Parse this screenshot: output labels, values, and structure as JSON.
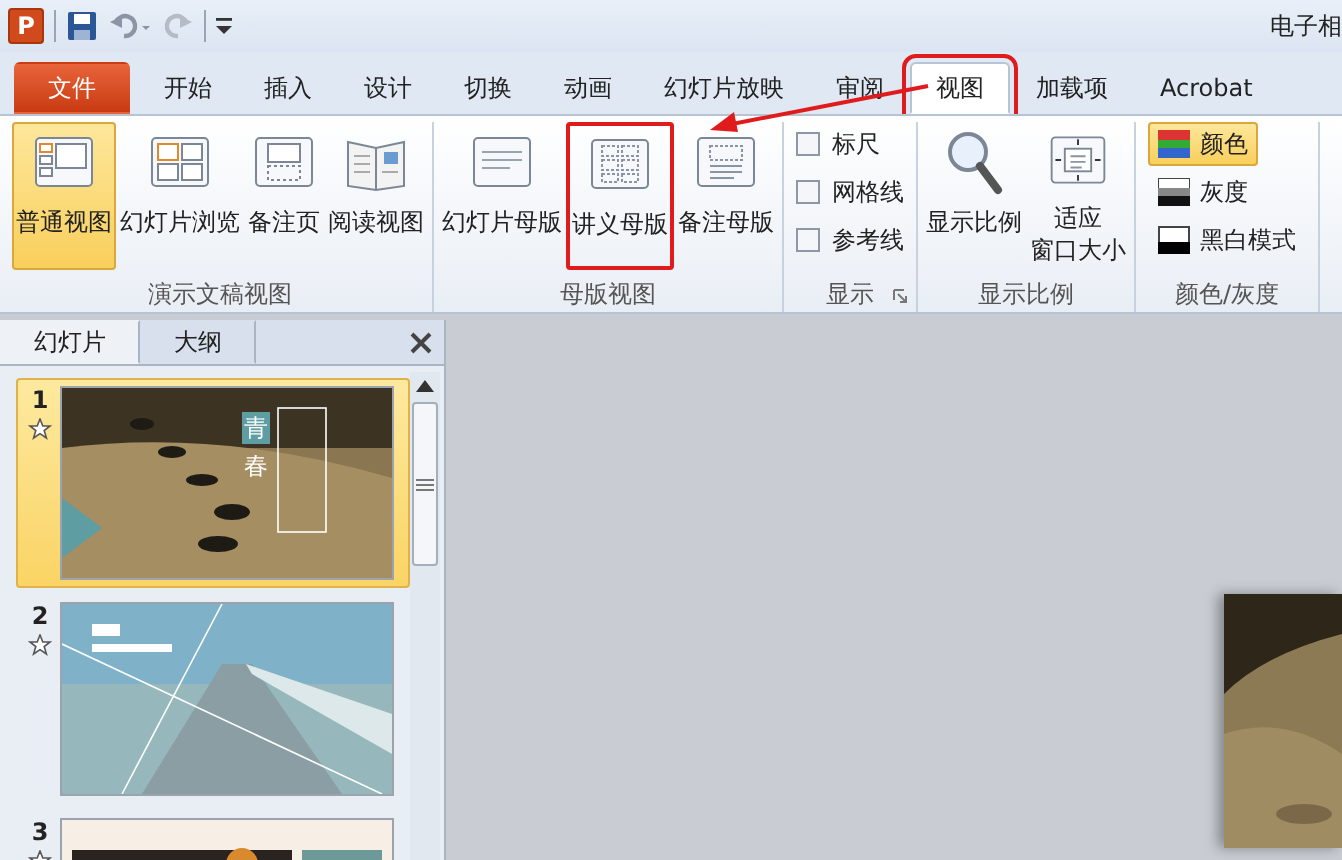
{
  "app_icon": "P",
  "title": "电子相",
  "callout_arrow": true,
  "tabs": [
    {
      "label": "文件",
      "kind": "file",
      "selected": false,
      "highlighted": false
    },
    {
      "label": "开始",
      "kind": "tab",
      "selected": false,
      "highlighted": false
    },
    {
      "label": "插入",
      "kind": "tab",
      "selected": false,
      "highlighted": false
    },
    {
      "label": "设计",
      "kind": "tab",
      "selected": false,
      "highlighted": false
    },
    {
      "label": "切换",
      "kind": "tab",
      "selected": false,
      "highlighted": false
    },
    {
      "label": "动画",
      "kind": "tab",
      "selected": false,
      "highlighted": false
    },
    {
      "label": "幻灯片放映",
      "kind": "tab",
      "selected": false,
      "highlighted": false
    },
    {
      "label": "审阅",
      "kind": "tab",
      "selected": false,
      "highlighted": false
    },
    {
      "label": "视图",
      "kind": "tab",
      "selected": true,
      "highlighted": true
    },
    {
      "label": "加载项",
      "kind": "tab",
      "selected": false,
      "highlighted": false
    },
    {
      "label": "Acrobat",
      "kind": "tab",
      "selected": false,
      "highlighted": false
    }
  ],
  "ribbon": [
    {
      "label": "演示文稿视图",
      "dialog_launcher": false,
      "controls": [
        {
          "kind": "large",
          "label": "普通视图",
          "selected": true,
          "highlighted": false
        },
        {
          "kind": "large",
          "label": "幻灯片浏览",
          "selected": false,
          "highlighted": false
        },
        {
          "kind": "large",
          "label": "备注页",
          "selected": false,
          "highlighted": false
        },
        {
          "kind": "large",
          "label": "阅读视图",
          "selected": false,
          "highlighted": false
        }
      ]
    },
    {
      "label": "母版视图",
      "dialog_launcher": false,
      "controls": [
        {
          "kind": "large",
          "label": "幻灯片母版",
          "selected": false,
          "highlighted": false
        },
        {
          "kind": "large",
          "label": "讲义母版",
          "selected": false,
          "highlighted": true
        },
        {
          "kind": "large",
          "label": "备注母版",
          "selected": false,
          "highlighted": false
        }
      ]
    },
    {
      "label": "显示",
      "dialog_launcher": true,
      "controls": [
        {
          "kind": "check",
          "label": "标尺",
          "checked": false
        },
        {
          "kind": "check",
          "label": "网格线",
          "checked": false
        },
        {
          "kind": "check",
          "label": "参考线",
          "checked": false
        }
      ]
    },
    {
      "label": "显示比例",
      "dialog_launcher": false,
      "controls": [
        {
          "kind": "large",
          "label": "显示比例",
          "selected": false,
          "highlighted": false
        },
        {
          "kind": "large",
          "label_lines": [
            "适应",
            "窗口大小"
          ],
          "selected": false,
          "highlighted": false
        }
      ]
    },
    {
      "label": "颜色/灰度",
      "dialog_launcher": false,
      "controls": [
        {
          "kind": "swatch",
          "label": "颜色",
          "selected": true
        },
        {
          "kind": "swatch",
          "label": "灰度",
          "selected": false
        },
        {
          "kind": "swatch",
          "label": "黑白模式",
          "selected": false
        }
      ]
    }
  ],
  "pane_tabs": [
    {
      "label": "幻灯片",
      "selected": true
    },
    {
      "label": "大纲",
      "selected": false
    }
  ],
  "slides": [
    {
      "number": "1",
      "selected": true,
      "title_chars": [
        "青",
        "春"
      ]
    },
    {
      "number": "2",
      "selected": false
    },
    {
      "number": "3",
      "selected": false
    }
  ]
}
